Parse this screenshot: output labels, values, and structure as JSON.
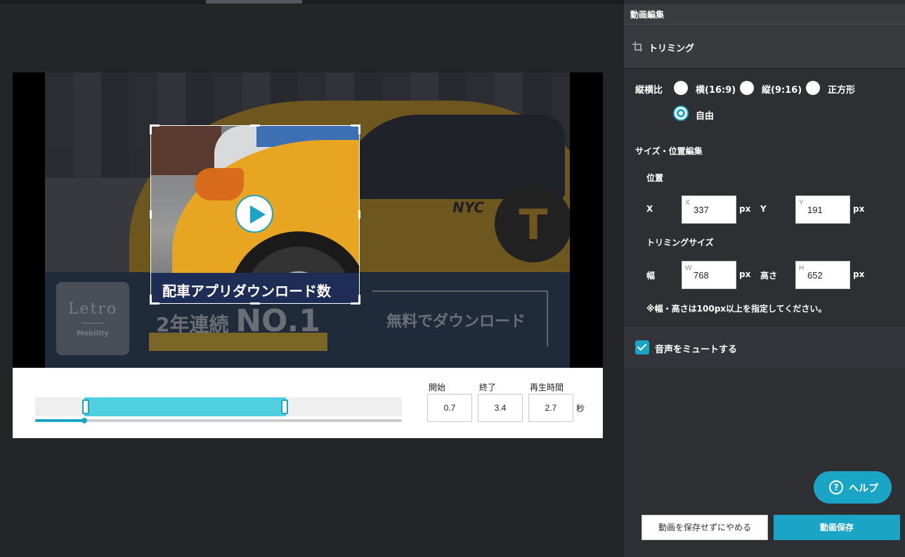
{
  "colors": {
    "accent": "#1aa5c7",
    "panel_bg": "#2e2f33",
    "canvas_bg": "#242527",
    "selection": "#4fcfdf"
  },
  "video": {
    "crop_caption": "配車アプリダウンロード数",
    "banner_headline": "2年連続 NO.1",
    "banner_headline_pre": "2年連続 ",
    "banner_headline_big": "NO.1",
    "banner_cta": "無料でダウンロード",
    "logo_name": "Letro",
    "logo_sub": "Mobility",
    "taxi_mark": "T",
    "taxi_text": "NYC",
    "play_icon": "play-icon"
  },
  "timeline": {
    "start_label": "開始",
    "end_label": "終了",
    "duration_label": "再生時間",
    "start_value": "0.7",
    "end_value": "3.4",
    "duration_value": "2.7",
    "unit": "秒",
    "playhead_fraction": 0.13,
    "selection_start_fraction": 0.13,
    "selection_end_fraction": 0.68
  },
  "panel": {
    "title": "動画編集",
    "section_title": "トリミング",
    "section_icon": "crop-icon",
    "aspect_label": "縦横比",
    "aspect_options": [
      "横(16:9)",
      "縦(9:16)",
      "正方形",
      "自由"
    ],
    "aspect_selected": "自由",
    "size_pos_title": "サイズ・位置編集",
    "position_label": "位置",
    "x_label": "X",
    "y_label": "Y",
    "x_tag": "X",
    "y_tag": "Y",
    "x_value": "337",
    "y_value": "191",
    "unit_px": "px",
    "trim_size_label": "トリミングサイズ",
    "width_label": "幅",
    "height_label": "高さ",
    "w_tag": "W",
    "h_tag": "H",
    "width_value": "768",
    "height_value": "652",
    "size_note": "※幅・高さは100px以上を指定してください。",
    "mute_label": "音声をミュートする",
    "mute_checked": true,
    "help_label": "ヘルプ",
    "help_icon": "question-icon",
    "cancel_label": "動画を保存せずにやめる",
    "save_label": "動画保存"
  }
}
